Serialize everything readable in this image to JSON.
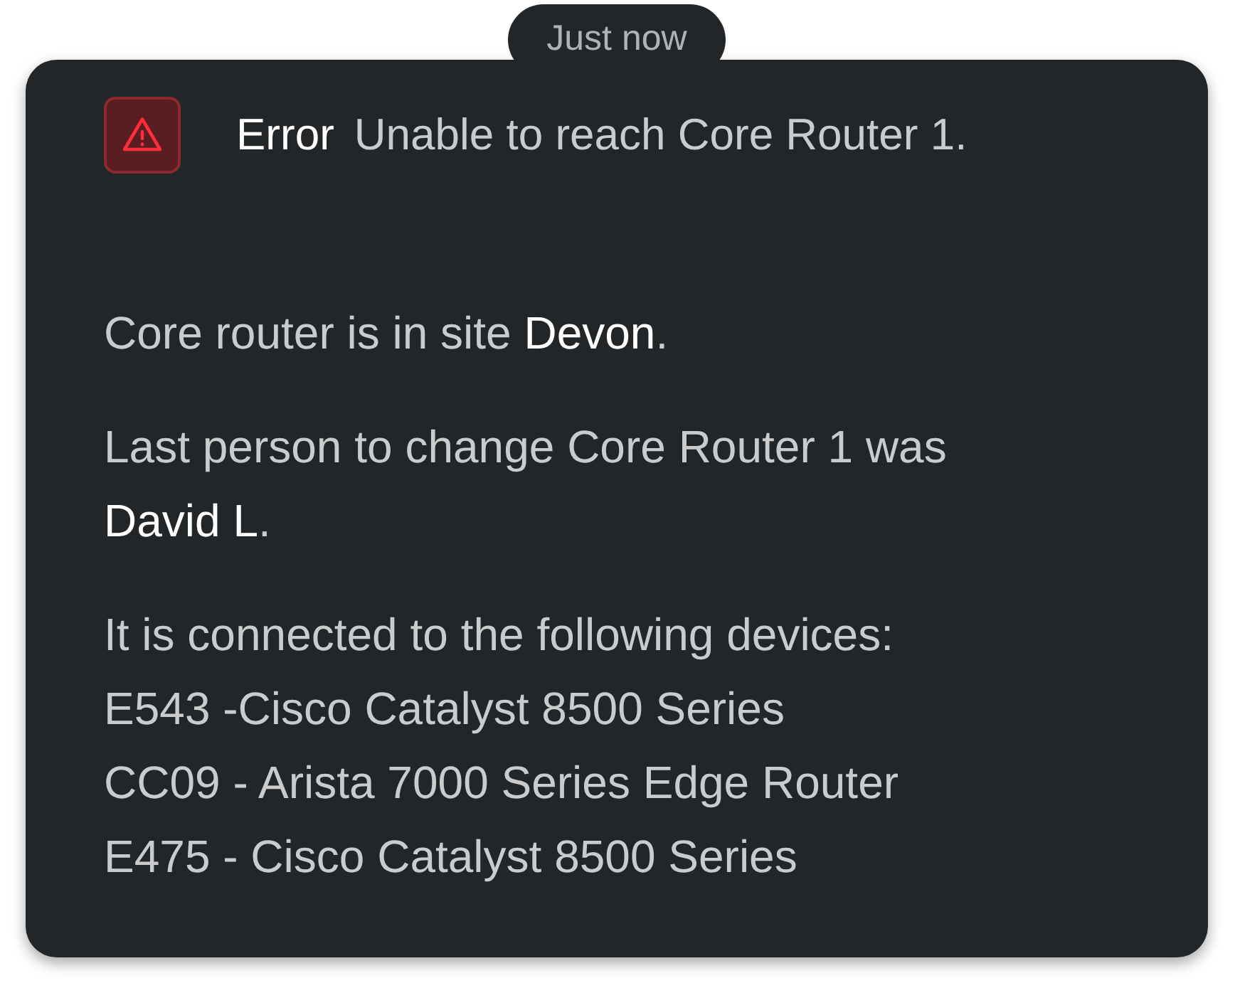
{
  "timestamp": "Just now",
  "alert": {
    "kind": "error",
    "label": "Error",
    "message": "Unable to reach Core Router 1."
  },
  "paragraphs": [
    "Core router is in site **Devon**.",
    "Last person to change Core Router 1 was **David L**."
  ],
  "devices_intro": "It is connected to the following devices:",
  "devices": [
    "E543 -Cisco Catalyst 8500 Series",
    "CC09 - Arista 7000 Series Edge Router",
    "E475 - Cisco Catalyst 8500 Series"
  ]
}
